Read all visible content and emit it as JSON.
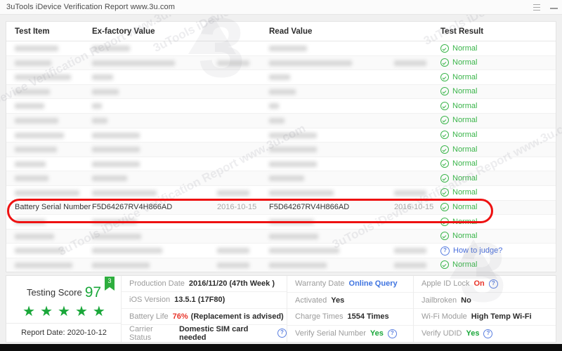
{
  "window": {
    "title": "3uTools iDevice Verification Report www.3u.com",
    "controls": [
      {
        "name": "list-icon",
        "label": ""
      },
      {
        "name": "minimize-icon",
        "label": ""
      }
    ]
  },
  "watermark": {
    "text": "3uTools iDevice Verification Report www.3u.com",
    "logo": "3"
  },
  "table": {
    "headers": [
      "Test Item",
      "Ex-factory Value",
      "Read Value",
      "Test Result"
    ],
    "rows": [
      {
        "item": "",
        "ex": "",
        "exdate": "",
        "read": "",
        "readdate": "",
        "result": "Normal",
        "result_type": "normal",
        "redacted": true,
        "w_item": 62,
        "w_ex": 54,
        "w_read": 54
      },
      {
        "item": "",
        "ex": "",
        "exdate": "",
        "read": "",
        "readdate": "",
        "result": "Normal",
        "result_type": "normal",
        "redacted": true,
        "w_item": 52,
        "w_ex": 118,
        "w_read": 118
      },
      {
        "item": "",
        "ex": "",
        "exdate": "",
        "read": "",
        "readdate": "",
        "result": "Normal",
        "result_type": "normal",
        "redacted": true,
        "w_item": 80,
        "w_ex": 30,
        "w_read": 30
      },
      {
        "item": "",
        "ex": "",
        "exdate": "",
        "read": "",
        "readdate": "",
        "result": "Normal",
        "result_type": "normal",
        "redacted": true,
        "w_item": 50,
        "w_ex": 38,
        "w_read": 38
      },
      {
        "item": "",
        "ex": "",
        "exdate": "",
        "read": "",
        "readdate": "",
        "result": "Normal",
        "result_type": "normal",
        "redacted": true,
        "w_item": 42,
        "w_ex": 14,
        "w_read": 14
      },
      {
        "item": "",
        "ex": "",
        "exdate": "",
        "read": "",
        "readdate": "",
        "result": "Normal",
        "result_type": "normal",
        "redacted": true,
        "w_item": 62,
        "w_ex": 22,
        "w_read": 22
      },
      {
        "item": "",
        "ex": "",
        "exdate": "",
        "read": "",
        "readdate": "",
        "result": "Normal",
        "result_type": "normal",
        "redacted": true,
        "w_item": 70,
        "w_ex": 68,
        "w_read": 68
      },
      {
        "item": "",
        "ex": "",
        "exdate": "",
        "read": "",
        "readdate": "",
        "result": "Normal",
        "result_type": "normal",
        "redacted": true,
        "w_item": 60,
        "w_ex": 68,
        "w_read": 68
      },
      {
        "item": "",
        "ex": "",
        "exdate": "",
        "read": "",
        "readdate": "",
        "result": "Normal",
        "result_type": "normal",
        "redacted": true,
        "w_item": 44,
        "w_ex": 68,
        "w_read": 68
      },
      {
        "item": "",
        "ex": "",
        "exdate": "",
        "read": "",
        "readdate": "",
        "result": "Normal",
        "result_type": "normal",
        "redacted": true,
        "w_item": 48,
        "w_ex": 50,
        "w_read": 50
      },
      {
        "item": "",
        "ex": "",
        "exdate": "",
        "read": "",
        "readdate": "",
        "result": "Normal",
        "result_type": "normal",
        "redacted": true,
        "w_item": 92,
        "w_ex": 92,
        "w_read": 92
      },
      {
        "item": "Battery Serial Number",
        "ex": "F5D64267RV4H866AD",
        "exdate": "2016-10-15",
        "read": "F5D64267RV4H866AD",
        "readdate": "2016-10-15",
        "result": "Normal",
        "result_type": "normal",
        "redacted": false,
        "highlighted": true
      },
      {
        "item": "",
        "ex": "",
        "exdate": "",
        "read": "",
        "readdate": "",
        "result": "Normal",
        "result_type": "normal",
        "redacted": true,
        "w_item": 44,
        "w_ex": 64,
        "w_read": 64
      },
      {
        "item": "",
        "ex": "",
        "exdate": "",
        "read": "",
        "readdate": "",
        "result": "Normal",
        "result_type": "normal",
        "redacted": true,
        "w_item": 56,
        "w_ex": 70,
        "w_read": 70
      },
      {
        "item": "",
        "ex": "",
        "exdate": "",
        "read": "",
        "readdate": "",
        "result": "How to judge?",
        "result_type": "link",
        "redacted": true,
        "w_item": 70,
        "w_ex": 100,
        "w_read": 100
      },
      {
        "item": "",
        "ex": "",
        "exdate": "",
        "read": "",
        "readdate": "",
        "result": "Normal",
        "result_type": "normal",
        "redacted": true,
        "w_item": 82,
        "w_ex": 82,
        "w_read": 82
      }
    ]
  },
  "summary": {
    "score_label": "Testing Score",
    "score_value": "97",
    "ribbon": "3",
    "stars": 5,
    "star_glyph": "★",
    "report_date_label": "Report Date:",
    "report_date_value": "2020-10-12",
    "col2": [
      {
        "key": "Production Date",
        "value": "2016/11/20 (47th Week )",
        "style": "plain",
        "help": false
      },
      {
        "key": "iOS Version",
        "value": "13.5.1 (17F80)",
        "style": "plain",
        "help": false
      },
      {
        "key": "Battery Life",
        "value": "76%",
        "value2": "(Replacement is advised)",
        "style": "red",
        "help": false
      },
      {
        "key": "Carrier Status",
        "value": "Domestic SIM card needed",
        "style": "plain",
        "help": true
      }
    ],
    "col3": [
      {
        "key": "Warranty Date",
        "value": "Online Query",
        "style": "link",
        "help": false
      },
      {
        "key": "Activated",
        "value": "Yes",
        "style": "plain",
        "help": false
      },
      {
        "key": "Charge Times",
        "value": "1554 Times",
        "style": "plain",
        "help": false
      },
      {
        "key": "Verify Serial Number",
        "value": "Yes",
        "style": "green",
        "help": true
      }
    ],
    "col4": [
      {
        "key": "Apple ID Lock",
        "value": "On",
        "style": "red",
        "help": true
      },
      {
        "key": "Jailbroken",
        "value": "No",
        "style": "plain",
        "help": false
      },
      {
        "key": "Wi-Fi Module",
        "value": "High Temp Wi-Fi",
        "style": "plain",
        "help": false
      },
      {
        "key": "Verify UDID",
        "value": "Yes",
        "style": "green",
        "help": true
      }
    ]
  },
  "colors": {
    "normal_green": "#3ab54a",
    "link_blue": "#4a6fdc",
    "alert_red": "#e8342a",
    "highlight_red": "#ee1111",
    "score_green": "#1aa73a"
  }
}
